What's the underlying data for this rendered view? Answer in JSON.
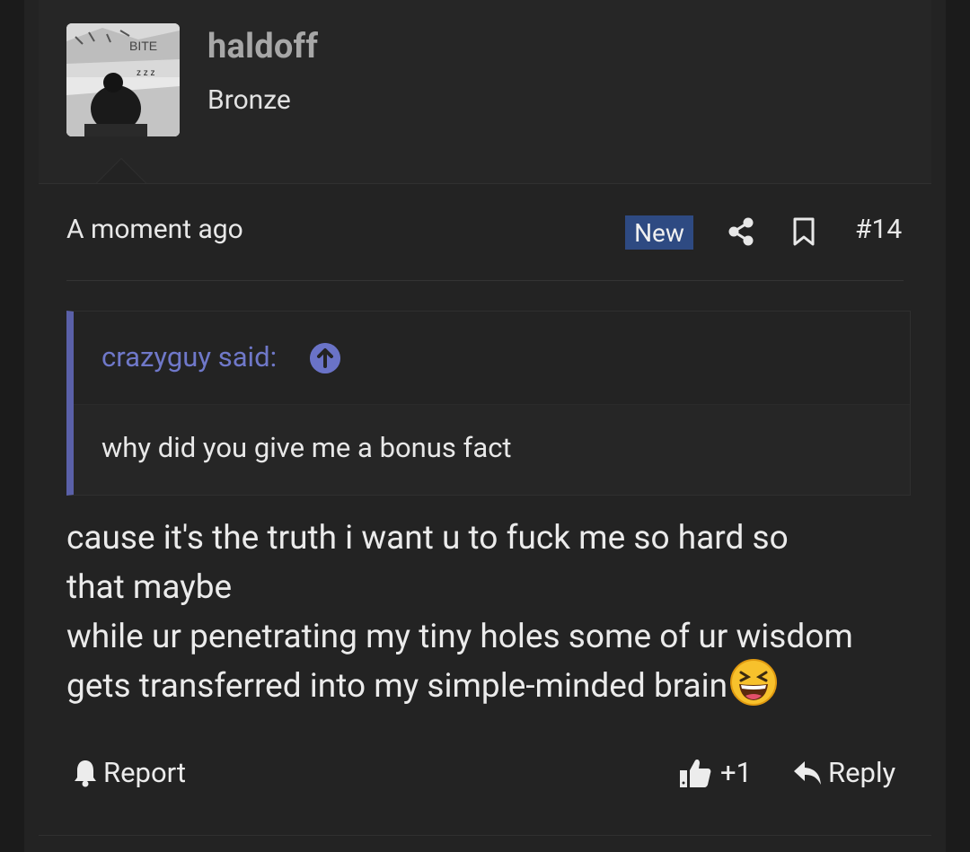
{
  "user": {
    "name": "haldoff",
    "title": "Bronze",
    "avatar_icon": "avatar-photo"
  },
  "meta": {
    "time": "A moment ago",
    "badge": "New",
    "post_number": "#14"
  },
  "quote": {
    "author": "crazyguy said:",
    "text": "why did you give me a bonus fact"
  },
  "message": {
    "line1": "cause it's the truth i want u to fuck me so hard so",
    "line2": "that maybe",
    "line3": "while ur penetrating my tiny holes some of ur wisdom",
    "line4": "gets transferred into my simple-minded brain"
  },
  "actions": {
    "report": "Report",
    "like_count": "+1",
    "reply": "Reply"
  },
  "colors": {
    "badge_bg": "#2e4a82",
    "quote_accent": "#5a60a8",
    "username": "#a7a7a7"
  }
}
